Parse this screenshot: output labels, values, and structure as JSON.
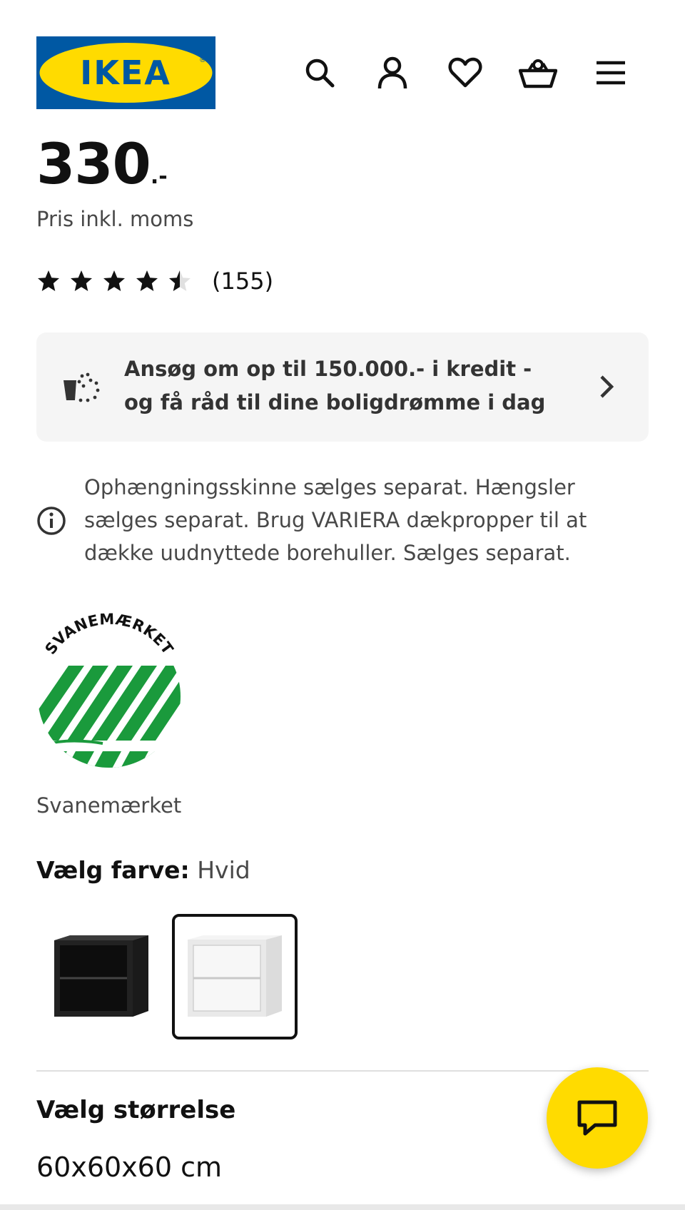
{
  "brand": {
    "logo_text": "IKEA",
    "registered_mark": "®",
    "blue": "#0058a3",
    "yellow": "#ffdb00"
  },
  "header": {
    "icons": [
      "search-icon",
      "account-icon",
      "heart-icon",
      "basket-icon",
      "menu-icon"
    ]
  },
  "price": {
    "amount": "330",
    "suffix": ".-",
    "note": "Pris inkl. moms"
  },
  "rating": {
    "stars": 4.5,
    "max": 5,
    "count": "(155)"
  },
  "credit_banner": {
    "icon": "coin-pouch-icon",
    "text": "Ansøg om op til 150.000.- i kredit - og få råd til dine boligdrømme i dag"
  },
  "info_note": {
    "icon": "info-icon",
    "text": "Ophængningsskinne sælges separat. Hængsler sælges separat. Brug VARIERA dækpropper til at dække uudnyttede borehuller. Sælges separat."
  },
  "eco_label": {
    "logo_text": "SVANEMÆRKET",
    "caption": "Svanemærket",
    "green": "#1a9a3c"
  },
  "color_choice": {
    "label": "Vælg farve:",
    "selected": "Hvid",
    "swatches": [
      "black-cabinet",
      "white-cabinet"
    ]
  },
  "size_choice": {
    "label": "Vælg størrelse",
    "value": "60x60x60 cm"
  },
  "chat": {
    "icon": "chat-icon"
  }
}
